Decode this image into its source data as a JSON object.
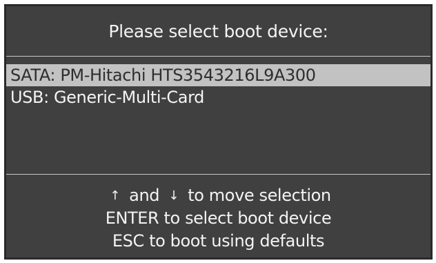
{
  "title": "Please select boot device:",
  "devices": [
    {
      "label": "SATA: PM-Hitachi HTS3543216L9A300",
      "selected": true
    },
    {
      "label": "USB: Generic-Multi-Card",
      "selected": false
    }
  ],
  "help": {
    "up_arrow": "↑",
    "and_text": "and",
    "down_arrow": "↓",
    "move_text": "to move selection",
    "enter_line": "ENTER to select boot device",
    "esc_line": "ESC to boot using defaults"
  },
  "colors": {
    "panel_bg": "#404040",
    "highlight_bg": "#c2c2c2",
    "text": "#f4f4f4",
    "highlight_text": "#2e2e2e"
  }
}
